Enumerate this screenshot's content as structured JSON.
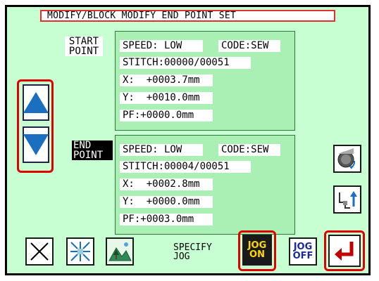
{
  "title": "MODIFY/BLOCK MODIFY  END POINT SET",
  "start_label": "START\nPOINT",
  "end_label": "END\nPOINT",
  "start": {
    "speed": "SPEED: LOW",
    "code": "CODE:SEW",
    "stitch": "STITCH:00000/00051",
    "x": "X:  +0003.7mm",
    "y": "Y:  +0010.0mm",
    "pf": "PF:+0000.0mm"
  },
  "end": {
    "speed": "SPEED: LOW",
    "code": "CODE:SEW",
    "stitch": "STITCH:00004/00051",
    "x": "X:  +0002.8mm",
    "y": "Y:  +0000.0mm",
    "pf": "PF:+0003.0mm"
  },
  "bottom": {
    "specify_jog": "SPECIFY\nJOG",
    "jog_on": "JOG\nON",
    "jog_off": "JOG\nOFF"
  },
  "colors": {
    "screen_bg": "#c8ffd2",
    "panel_bg": "#aaf0b4",
    "highlight": "#e00000",
    "arrow": "#1a6fc0",
    "jog_on_bg": "#1a1a1a",
    "jog_on_text": "#ffd800"
  },
  "icons": {
    "up": "arrow-up-icon",
    "down": "arrow-down-icon",
    "close": "close-icon",
    "expand": "expand-icon",
    "scenery": "landscape-icon",
    "rotate": "gear-rotate-icon",
    "needle": "needle-up-icon",
    "enter": "enter-icon"
  }
}
